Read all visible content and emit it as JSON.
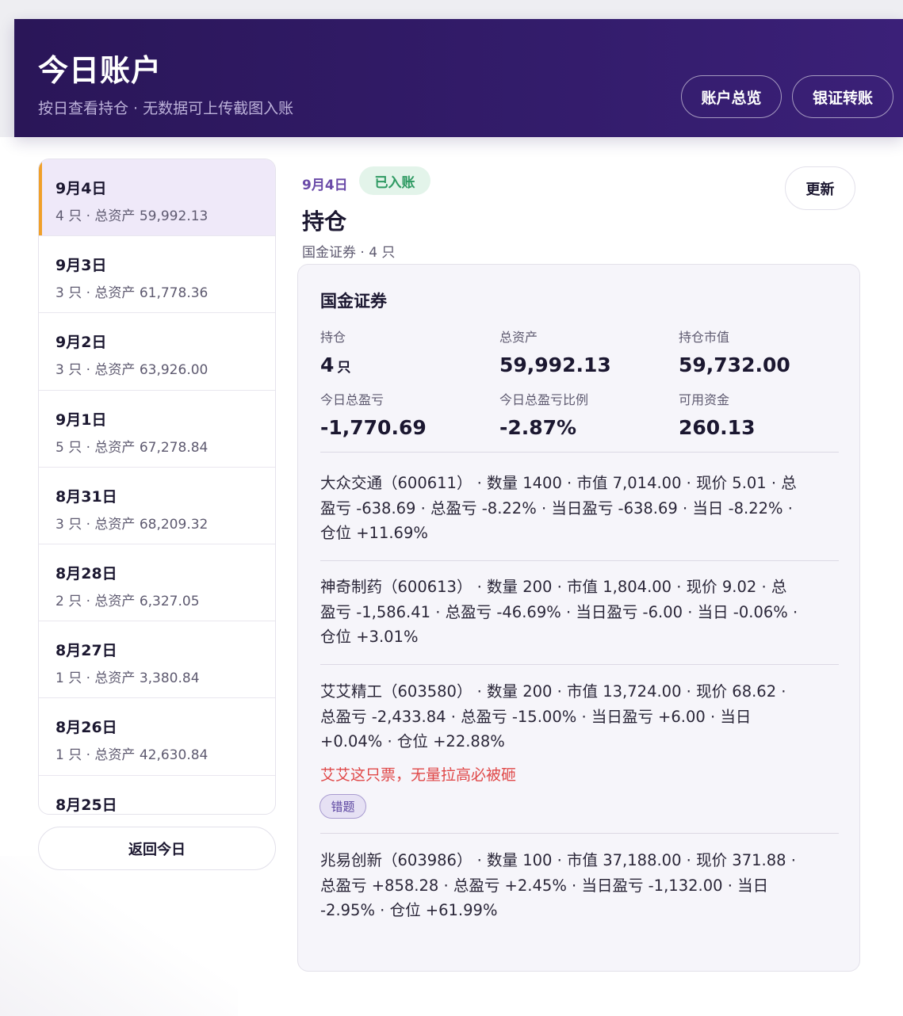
{
  "header": {
    "title": "今日账户",
    "subtitle": "按日查看持仓 · 无数据可上传截图入账",
    "overview_button": "账户总览",
    "transfer_button": "银证转账"
  },
  "date_list": [
    {
      "date": "9月4日",
      "meta": "4 只 · 总资产 59,992.13",
      "active": true
    },
    {
      "date": "9月3日",
      "meta": "3 只 · 总资产 61,778.36"
    },
    {
      "date": "9月2日",
      "meta": "3 只 · 总资产 63,926.00"
    },
    {
      "date": "9月1日",
      "meta": "5 只 · 总资产 67,278.84"
    },
    {
      "date": "8月31日",
      "meta": "3 只 · 总资产 68,209.32"
    },
    {
      "date": "8月28日",
      "meta": "2 只 · 总资产 6,327.05"
    },
    {
      "date": "8月27日",
      "meta": "1 只 · 总资产 3,380.84"
    },
    {
      "date": "8月26日",
      "meta": "1 只 · 总资产 42,630.84"
    },
    {
      "date": "8月25日",
      "meta": ""
    }
  ],
  "today_button": "返回今日",
  "detail": {
    "date": "9月4日",
    "status_badge": "已入账",
    "refresh_button": "更新",
    "title": "持仓",
    "subtitle": "国金证券 · 4 只"
  },
  "card": {
    "broker": "国金证券",
    "stats": {
      "holdings_label": "持仓",
      "holdings_value": "4",
      "holdings_unit": "只",
      "total_assets_label": "总资产",
      "total_assets_value": "59,992.13",
      "market_value_label": "持仓市值",
      "market_value_value": "59,732.00",
      "today_pnl_label": "今日总盈亏",
      "today_pnl_value": "-1,770.69",
      "today_pnl_pct_label": "今日总盈亏比例",
      "today_pnl_pct_value": "-2.87%",
      "cash_label": "可用资金",
      "cash_value": "260.13"
    },
    "holdings": [
      {
        "line1": "大众交通（600611） · 数量 1400 · 市值 7,014.00 · 现价 5.01 · 总",
        "line2": "盈亏 -638.69 · 总盈亏 -8.22% · 当日盈亏 -638.69 · 当日 -8.22% ·",
        "line3": "仓位 +11.69%"
      },
      {
        "line1": "神奇制药（600613） · 数量 200 · 市值 1,804.00 · 现价 9.02 · 总",
        "line2": "盈亏 -1,586.41 · 总盈亏 -46.69% · 当日盈亏 -6.00 · 当日 -0.06% ·",
        "line3": "仓位 +3.01%"
      },
      {
        "line1": "艾艾精工（603580） · 数量 200 · 市值 13,724.00 · 现价 68.62 ·",
        "line2": "总盈亏 -2,433.84 · 总盈亏 -15.00% · 当日盈亏 +6.00 · 当日",
        "line3": "+0.04% · 仓位 +22.88%",
        "note": "艾艾这只票，无量拉高必被砸",
        "tag": "错题"
      },
      {
        "line1": "兆易创新（603986） · 数量 100 · 市值 37,188.00 · 现价 371.88 ·",
        "line2": "总盈亏 +858.28 · 总盈亏 +2.45% · 当日盈亏 -1,132.00 · 当日",
        "line3": "-2.95% · 仓位 +61.99%"
      }
    ]
  }
}
